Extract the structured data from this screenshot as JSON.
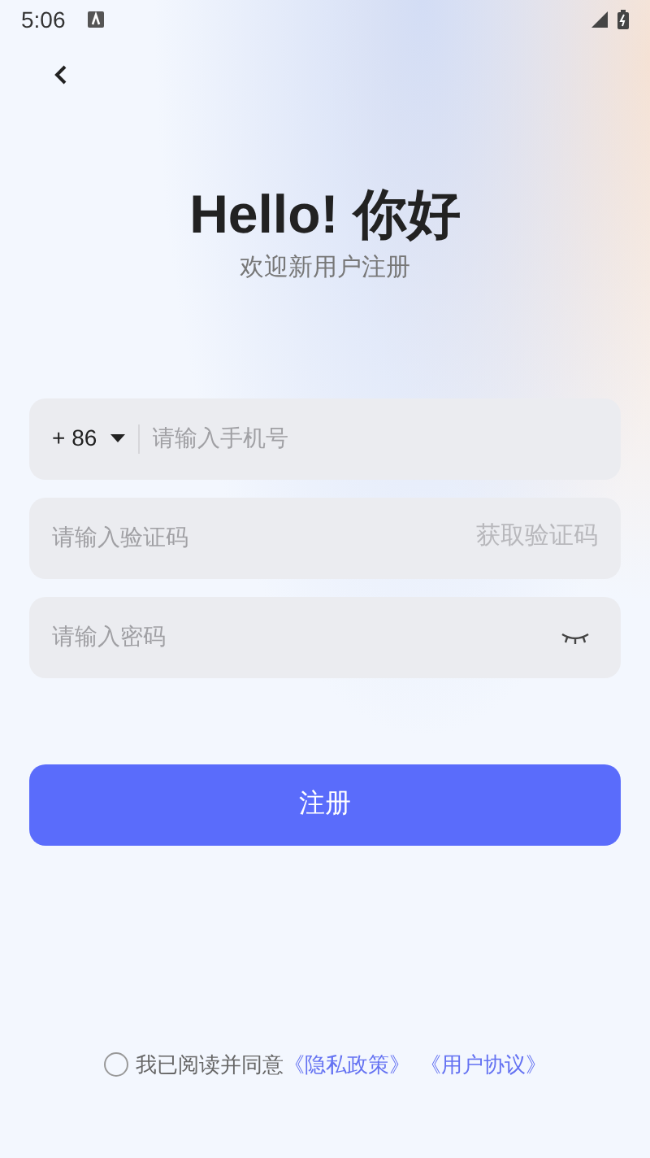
{
  "status_bar": {
    "time": "5:06"
  },
  "title": "Hello! 你好",
  "subtitle": "欢迎新用户注册",
  "phone_field": {
    "country_code": "+ 86",
    "placeholder": "请输入手机号"
  },
  "code_field": {
    "placeholder": "请输入验证码",
    "action": "获取验证码"
  },
  "password_field": {
    "placeholder": "请输入密码"
  },
  "submit_button": "注册",
  "agreement": {
    "checked": false,
    "text": "我已阅读并同意",
    "links": [
      "《隐私政策》",
      "《用户协议》"
    ]
  }
}
